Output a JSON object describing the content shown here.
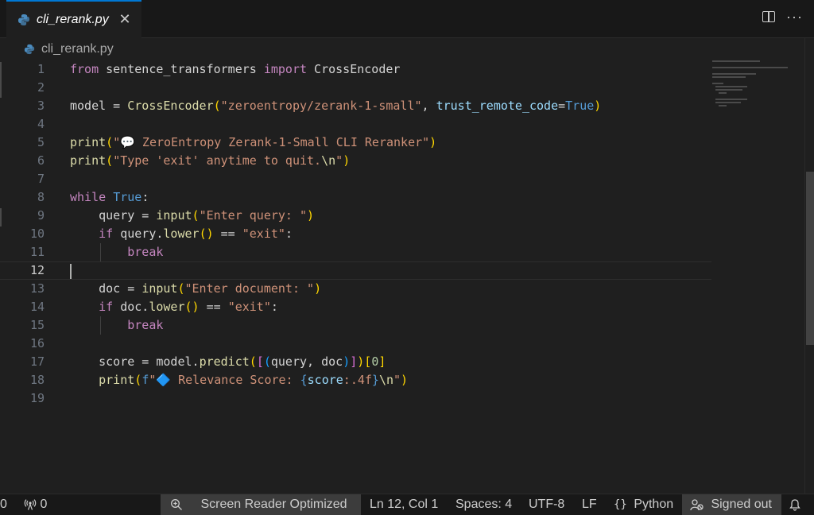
{
  "tab": {
    "title": "cli_rerank.py",
    "close": "✕"
  },
  "breadcrumb": {
    "file": "cli_rerank.py"
  },
  "editor": {
    "line_numbers": [
      "1",
      "2",
      "3",
      "4",
      "5",
      "6",
      "7",
      "8",
      "9",
      "10",
      "11",
      "12",
      "13",
      "14",
      "15",
      "16",
      "17",
      "18",
      "19"
    ],
    "active_line": 12,
    "code_text": [
      "from sentence_transformers import CrossEncoder",
      "",
      "model = CrossEncoder(\"zeroentropy/zerank-1-small\", trust_remote_code=True)",
      "",
      "print(\"💬 ZeroEntropy Zerank-1-Small CLI Reranker\")",
      "print(\"Type 'exit' anytime to quit.\\n\")",
      "",
      "while True:",
      "    query = input(\"Enter query: \")",
      "    if query.lower() == \"exit\":",
      "        break",
      "",
      "    doc = input(\"Enter document: \")",
      "    if doc.lower() == \"exit\":",
      "        break",
      "",
      "    score = model.predict([(query, doc)])[0]",
      "    print(f\"🔷 Relevance Score: {score:.4f}\\n\")",
      ""
    ]
  },
  "statusbar": {
    "errors": "0",
    "ports": "0",
    "screen_reader": "Screen Reader Optimized",
    "position": "Ln 12, Col 1",
    "spaces": "Spaces: 4",
    "encoding": "UTF-8",
    "eol": "LF",
    "language": "Python",
    "account": "Signed out"
  },
  "icons": {
    "file": "python-file-icon",
    "split": "split-editor-icon",
    "more": "more-actions-icon",
    "zoom": "zoom-icon",
    "broadcast": "ports-icon",
    "braces": "braces-icon",
    "account": "account-icon",
    "bell": "bell-icon"
  },
  "colors": {
    "accent": "#0078d4",
    "keyword": "#c586c0",
    "string": "#ce9178",
    "function": "#dcdcaa",
    "builtin": "#569cd6"
  }
}
